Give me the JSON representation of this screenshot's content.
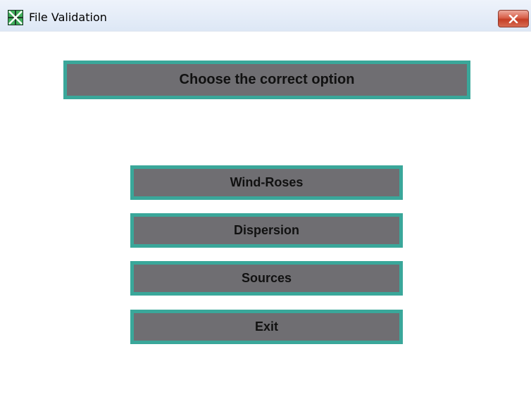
{
  "window": {
    "title": "File Validation",
    "app_icon": "grid-app-icon",
    "close_icon": "close-icon"
  },
  "main": {
    "header": "Choose the correct option",
    "buttons": {
      "wind_roses": "Wind-Roses",
      "dispersion": "Dispersion",
      "sources": "Sources",
      "exit": "Exit"
    }
  },
  "colors": {
    "button_fill": "#6f6e72",
    "button_border": "#3aa79a",
    "close_red": "#c43e25"
  }
}
